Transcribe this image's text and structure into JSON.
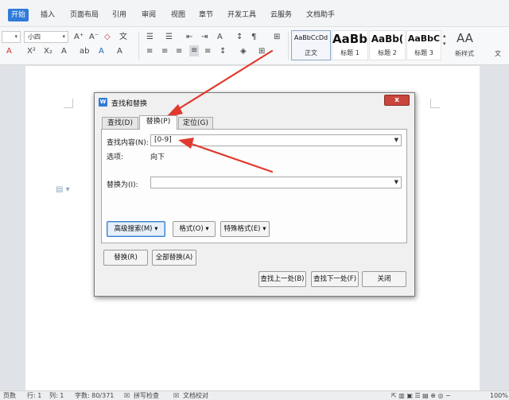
{
  "menu": {
    "start": "开始",
    "items": [
      "插入",
      "页面布局",
      "引用",
      "审阅",
      "视图",
      "章节",
      "开发工具",
      "云服务",
      "文档助手"
    ]
  },
  "ribbon": {
    "font_size": "小四",
    "styles": [
      {
        "sample": "AaBbCcDd",
        "name": "正文"
      },
      {
        "sample": "AaBb",
        "name": "标题 1"
      },
      {
        "sample": "AaBb(",
        "name": "标题 2"
      },
      {
        "sample": "AaBbC",
        "name": "标题 3"
      }
    ],
    "new_style_sample": "AA",
    "new_style": "新样式",
    "text_tools": "文"
  },
  "dialog": {
    "title": "查找和替换",
    "close": "x",
    "tabs": [
      "查找(D)",
      "替换(P)",
      "定位(G)"
    ],
    "find_label": "查找内容(N):",
    "find_value": "[0-9]",
    "options_label": "选项:",
    "options_value": "向下",
    "replace_label": "替换为(I):",
    "replace_value": "",
    "advanced_button": "高级搜索(M)",
    "format_button": "格式(O)",
    "special_button": "特殊格式(E)",
    "replace_button": "替换(R)",
    "replace_all_button": "全部替换(A)",
    "find_prev_button": "查找上一处(B)",
    "find_next_button": "查找下一处(F)",
    "close_button": "关闭"
  },
  "status": {
    "page": "页数",
    "line": "行: 1",
    "col": "列: 1",
    "words": "字数: 80/371",
    "spell": "拼写检查",
    "proof": "文档校对",
    "zoom": "100%"
  },
  "colors": {
    "accent": "#2f7bd9",
    "annotation_arrow": "#e03a2e",
    "close_button": "#c8463c"
  }
}
